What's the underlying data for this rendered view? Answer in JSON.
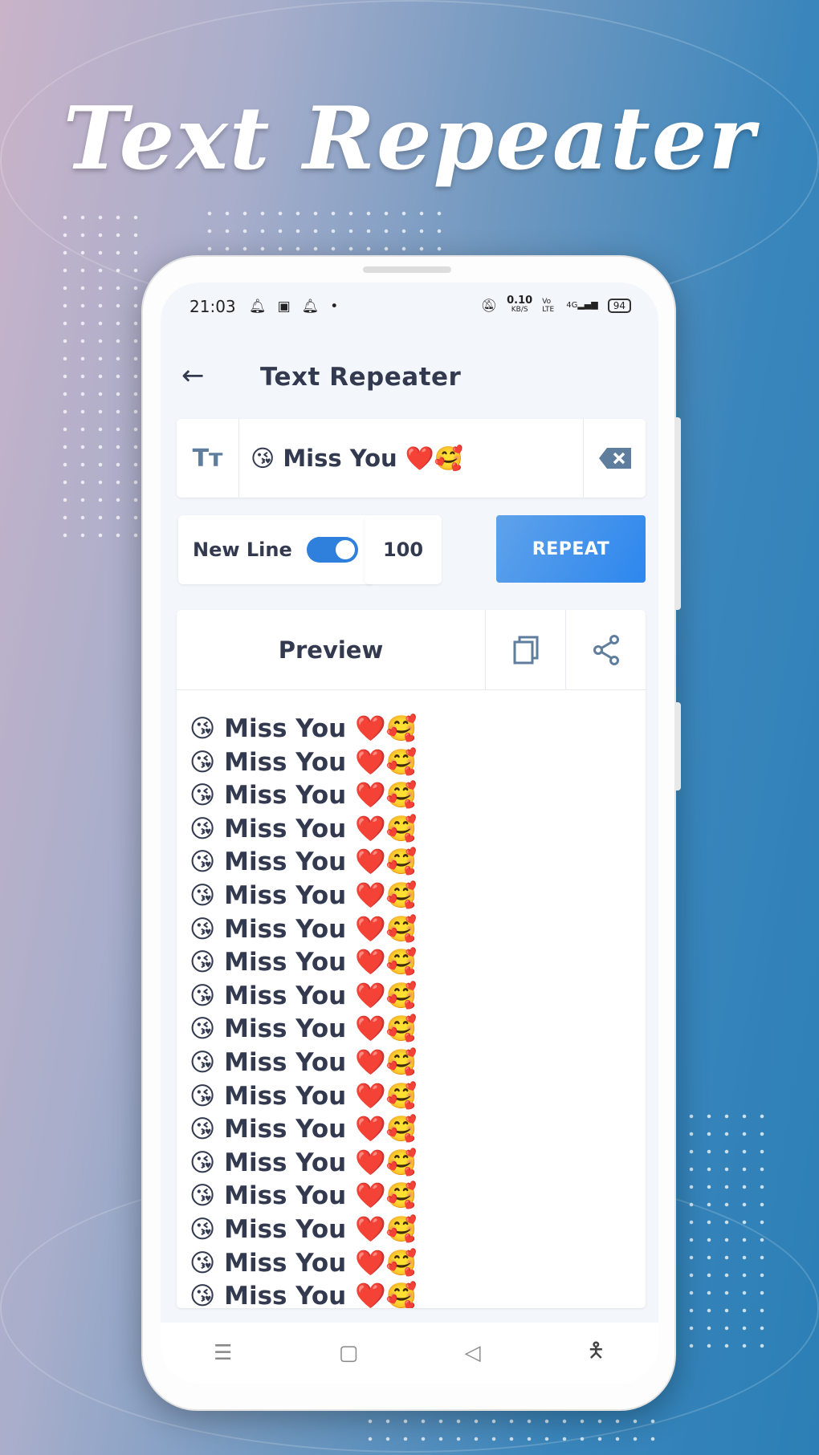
{
  "promo_title": "Text Repeater",
  "status_bar": {
    "time": "21:03",
    "speed_value": "0.10",
    "speed_unit": "KB/S",
    "volte": "Vo LTE",
    "network": "4G",
    "battery": "94"
  },
  "app_bar": {
    "title": "Text Repeater",
    "back_icon": "arrow-left-icon"
  },
  "input": {
    "value": "😘 Miss You ❤️🥰",
    "left_icon": "text-size-icon",
    "left_icon_label": "Tт",
    "clear_icon": "backspace-icon"
  },
  "options": {
    "new_line_label": "New Line",
    "new_line_enabled": true,
    "repeat_count": "100",
    "repeat_button": "REPEAT"
  },
  "preview": {
    "title": "Preview",
    "copy_icon": "copy-icon",
    "share_icon": "share-icon",
    "line": "😘 Miss You ❤️🥰",
    "visible_lines": 18
  },
  "nav_bar": {
    "icons": [
      "menu-icon",
      "home-square-icon",
      "back-triangle-icon",
      "accessibility-icon"
    ]
  },
  "colors": {
    "accent": "#2f80dc",
    "text": "#333a4f",
    "icon": "#5f7d9c"
  }
}
